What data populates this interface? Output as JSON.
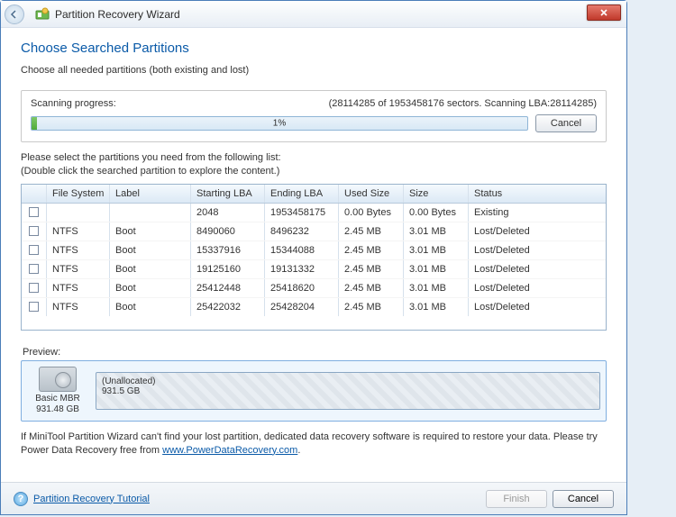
{
  "titlebar": {
    "title": "Partition Recovery Wizard"
  },
  "heading": "Choose Searched Partitions",
  "subtext": "Choose all needed partitions (both existing and lost)",
  "scan": {
    "label": "Scanning progress:",
    "status": "(28114285 of 1953458176 sectors. Scanning LBA:28114285)",
    "percent": "1%",
    "cancel": "Cancel"
  },
  "listhint_l1": "Please select the partitions you need from the following list:",
  "listhint_l2": "(Double click the searched partition to explore the content.)",
  "columns": {
    "fs": "File System",
    "label": "Label",
    "slba": "Starting LBA",
    "elba": "Ending LBA",
    "used": "Used Size",
    "size": "Size",
    "status": "Status"
  },
  "rows": [
    {
      "fs": "",
      "label": "",
      "slba": "2048",
      "elba": "1953458175",
      "used": "0.00 Bytes",
      "size": "0.00 Bytes",
      "status": "Existing"
    },
    {
      "fs": "NTFS",
      "label": "Boot",
      "slba": "8490060",
      "elba": "8496232",
      "used": "2.45 MB",
      "size": "3.01 MB",
      "status": "Lost/Deleted"
    },
    {
      "fs": "NTFS",
      "label": "Boot",
      "slba": "15337916",
      "elba": "15344088",
      "used": "2.45 MB",
      "size": "3.01 MB",
      "status": "Lost/Deleted"
    },
    {
      "fs": "NTFS",
      "label": "Boot",
      "slba": "19125160",
      "elba": "19131332",
      "used": "2.45 MB",
      "size": "3.01 MB",
      "status": "Lost/Deleted"
    },
    {
      "fs": "NTFS",
      "label": "Boot",
      "slba": "25412448",
      "elba": "25418620",
      "used": "2.45 MB",
      "size": "3.01 MB",
      "status": "Lost/Deleted"
    },
    {
      "fs": "NTFS",
      "label": "Boot",
      "slba": "25422032",
      "elba": "25428204",
      "used": "2.45 MB",
      "size": "3.01 MB",
      "status": "Lost/Deleted"
    }
  ],
  "preview": {
    "label": "Preview:",
    "disk_name": "Basic MBR",
    "disk_size": "931.48 GB",
    "part_name": "(Unallocated)",
    "part_size": "931.5 GB"
  },
  "note": {
    "text_a": "If MiniTool Partition Wizard can't find your lost partition, dedicated data recovery software is required to restore your data. Please try Power Data Recovery free from ",
    "link": "www.PowerDataRecovery.com",
    "text_b": "."
  },
  "footer": {
    "help": "Partition Recovery Tutorial",
    "finish": "Finish",
    "cancel": "Cancel"
  }
}
